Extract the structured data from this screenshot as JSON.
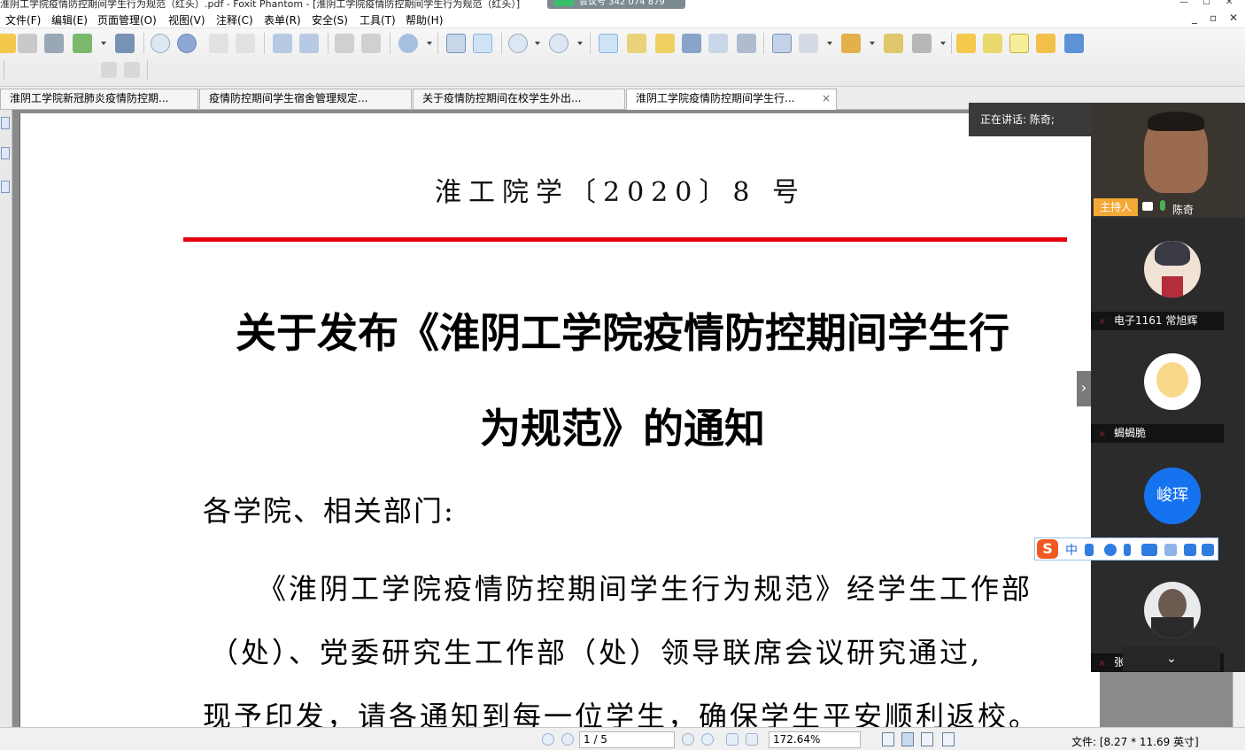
{
  "window": {
    "title": "淮阴工学院疫情防控期间学生行为规范（红头）.pdf - Foxit Phantom - [淮阴工学院疫情防控期间学生行为规范（红头）]",
    "meeting_id_label": "会议号 342 074 879"
  },
  "menu": {
    "items": [
      "文件(F)",
      "编辑(E)",
      "页面管理(O)",
      "视图(V)",
      "注释(C)",
      "表单(R)",
      "安全(S)",
      "工具(T)",
      "帮助(H)"
    ]
  },
  "toolbar": {
    "icons": [
      "open-icon",
      "save-icon",
      "print-icon",
      "email-icon",
      "scan-icon",
      "prev-page-icon",
      "next-page-icon",
      "back-icon",
      "forward-icon",
      "extract-icon",
      "insert-icon",
      "undo-icon",
      "redo-icon",
      "zoom-in-icon",
      "fit-width-icon",
      "fit-page-icon",
      "zoom-out-minus-icon",
      "zoom-in-plus-icon",
      "hand-tool-icon",
      "text-select-icon",
      "select-tool-icon",
      "find-icon",
      "typewriter-icon",
      "snapshot-icon",
      "rectangle-icon",
      "form-icon",
      "stamp-icon",
      "sign-icon",
      "lock-icon",
      "highlight-icon",
      "edit-icon",
      "textbox-icon",
      "comment-icon",
      "arrow-icon"
    ]
  },
  "tabs": [
    {
      "label": "淮阴工学院新冠肺炎疫情防控期...",
      "active": false
    },
    {
      "label": "疫情防控期间学生宿舍管理规定...",
      "active": false
    },
    {
      "label": "关于疫情防控期间在校学生外出...",
      "active": false
    },
    {
      "label": "淮阴工学院疫情防控期间学生行...",
      "active": true
    }
  ],
  "document": {
    "doc_number": "淮工院学〔2020〕8 号",
    "title_line1": "关于发布《淮阴工学院疫情防控期间学生行",
    "title_line2": "为规范》的通知",
    "salutation": "各学院、相关部门:",
    "para_line1": "《淮阴工学院疫情防控期间学生行为规范》经学生工作部",
    "para_line2": "（处）、党委研究生工作部（处）领导联席会议研究通过,",
    "para_line3": "现予印发，请各通知到每一位学生，确保学生平安顺利返校。",
    "header_line_color": "#e60012"
  },
  "statusbar": {
    "page_indicator": "1 / 5",
    "zoom": "172.64%",
    "file_size": "文件: [8.27 * 11.69 英寸]"
  },
  "meeting": {
    "speaking_label": "正在讲话: 陈奇;",
    "host_badge": "主持人",
    "participants": [
      {
        "name": "陈奇",
        "host": true,
        "video": true
      },
      {
        "name": "电子1161 常旭辉",
        "host": false,
        "video": false
      },
      {
        "name": "蝎蝎脆",
        "host": false,
        "video": false
      },
      {
        "name": "峻珲",
        "host": false,
        "video": false,
        "initials": "峻珲"
      },
      {
        "name": "张广志",
        "host": false,
        "video": false
      }
    ],
    "expand_glyph": "›",
    "collapse_glyph": "⌄"
  },
  "ime": {
    "zh_label": "中"
  },
  "colors": {
    "accent_red": "#e60012",
    "host_orange": "#f4a836",
    "avatar_blue": "#1673f0"
  }
}
